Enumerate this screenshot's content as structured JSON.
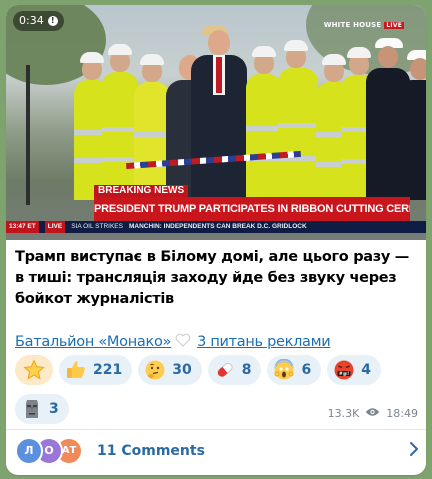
{
  "video": {
    "duration": "0:34",
    "watermark": "WHITE HOUSE",
    "live_badge": "LIVE",
    "chyron_tag": "BREAKING NEWS",
    "chyron_headline": "PRESIDENT TRUMP PARTICIPATES IN RIBBON CUTTING CEREMONY",
    "ticker": {
      "time": "13:47 ET",
      "network": "LIVE",
      "text1": "SIA OIL STRIKES",
      "text2": "MANCHIN: INDEPENDENTS CAN BREAK D.C. GRIDLOCK"
    }
  },
  "post": {
    "text": "Трамп виступає в Білому домі, але цього разу — в тиші: трансляція заходу йде без звуку через бойкот журналістів",
    "link1": "Батальйон «Монако»",
    "link2": "3 питань реклами"
  },
  "reactions": [
    {
      "emoji": "star",
      "count": ""
    },
    {
      "emoji": "thumbs-up",
      "count": "221"
    },
    {
      "emoji": "thinking",
      "count": "30"
    },
    {
      "emoji": "pill",
      "count": "8"
    },
    {
      "emoji": "scream",
      "count": "6"
    },
    {
      "emoji": "angry-swear",
      "count": "4"
    },
    {
      "emoji": "moai",
      "count": "3"
    }
  ],
  "meta": {
    "views": "13.3K",
    "time": "18:49"
  },
  "comments": {
    "avatars": [
      {
        "letter": "Л",
        "color": "#5b8fe0"
      },
      {
        "letter": "О",
        "color": "#9a76d8"
      },
      {
        "letter": "АТ",
        "color": "#f08a5b"
      }
    ],
    "label": "11 Comments"
  },
  "colors": {
    "accent": "#2b6aa3",
    "link": "#1b6fb5",
    "chat_bg": "#7fa36f",
    "breaking_red": "#c9161d"
  }
}
